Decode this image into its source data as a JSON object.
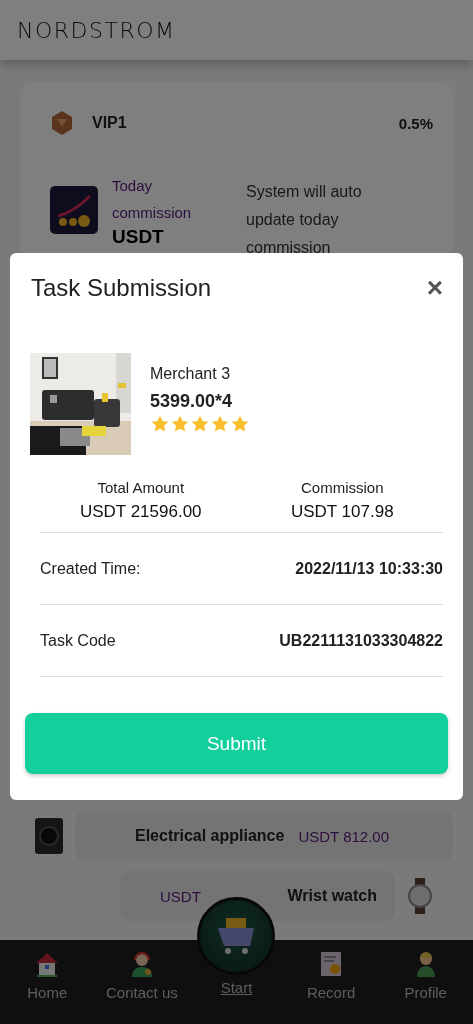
{
  "header": {
    "logo": "NORDSTROM"
  },
  "vip": {
    "level": "VIP1",
    "rate": "0.5%"
  },
  "commission": {
    "title": "Today commission",
    "amount": "USDT",
    "note": "System will auto update today commission"
  },
  "products": [
    {
      "kind": "appliance",
      "name": "Electrical appliance",
      "price": "USDT 812.00"
    },
    {
      "kind": "watch",
      "name": "Wrist watch",
      "price": "USDT"
    }
  ],
  "modal": {
    "title": "Task Submission",
    "close": "×",
    "product": {
      "kind": "picture",
      "merchant": "Merchant 3",
      "price": "5399.00*4",
      "stars": 5
    },
    "totals": [
      {
        "label": "Total Amount",
        "value": "USDT 21596.00"
      },
      {
        "label": "Commission",
        "value": "USDT 107.98"
      }
    ],
    "details": [
      {
        "label": "Created Time:",
        "value": "2022/11/13 10:33:30"
      },
      {
        "label": "Task Code",
        "value": "UB2211131033304822"
      }
    ],
    "submit": "Submit"
  },
  "nav": [
    {
      "kind": "home",
      "label": "Home",
      "selected": false
    },
    {
      "kind": "contact",
      "label": "Contact us",
      "selected": false
    },
    {
      "kind": "start",
      "label": "Start",
      "selected": true
    },
    {
      "kind": "record",
      "label": "Record",
      "selected": false
    },
    {
      "kind": "profile",
      "label": "Profile",
      "selected": false
    }
  ]
}
